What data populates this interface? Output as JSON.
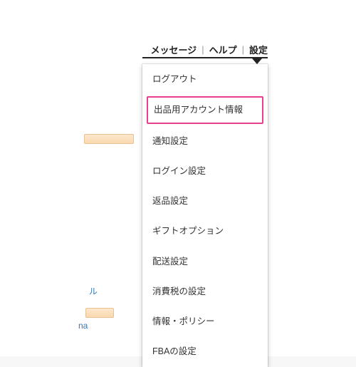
{
  "topbar": {
    "messages": "メッセージ",
    "help": "ヘルプ",
    "settings": "設定"
  },
  "dropdown": {
    "items": [
      {
        "label": "ログアウト",
        "highlight": false
      },
      {
        "label": "出品用アカウント情報",
        "highlight": true
      },
      {
        "label": "通知設定",
        "highlight": false
      },
      {
        "label": "ログイン設定",
        "highlight": false
      },
      {
        "label": "返品設定",
        "highlight": false
      },
      {
        "label": "ギフトオプション",
        "highlight": false
      },
      {
        "label": "配送設定",
        "highlight": false
      },
      {
        "label": "消費税の設定",
        "highlight": false
      },
      {
        "label": "情報・ポリシー",
        "highlight": false
      },
      {
        "label": "FBAの設定",
        "highlight": false
      }
    ]
  },
  "bg": {
    "link_a": "ル",
    "link_b": "na"
  }
}
